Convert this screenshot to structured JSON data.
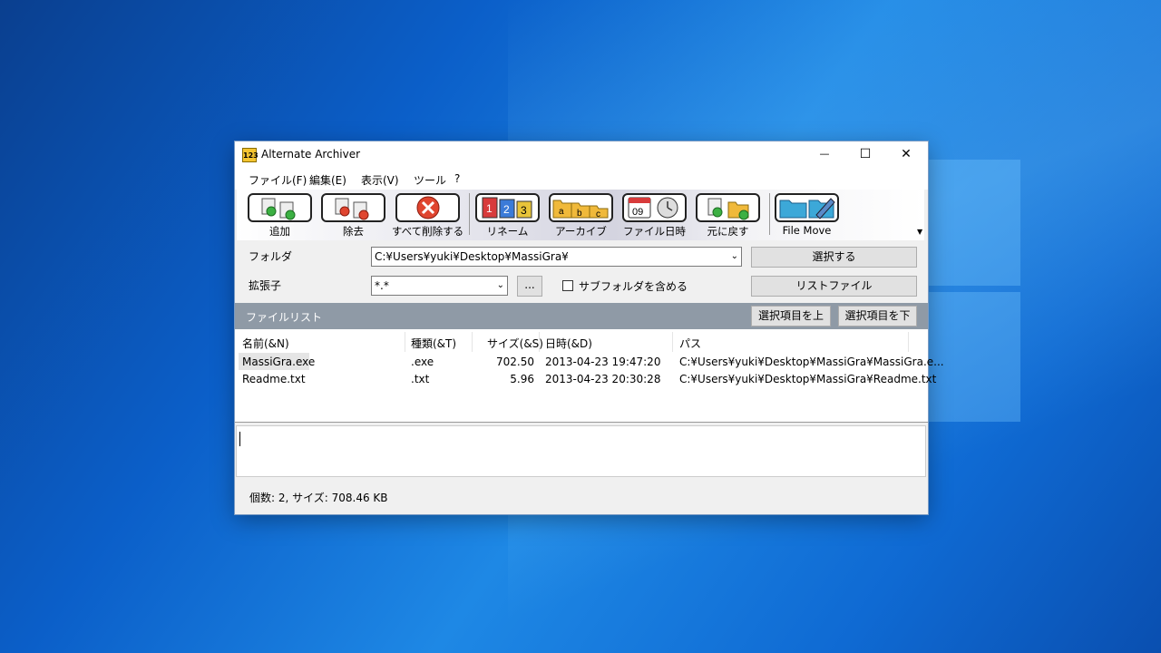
{
  "window": {
    "title": "Alternate Archiver"
  },
  "titlebar_buttons": {
    "minimize": "—",
    "maximize": "☐",
    "close": "✕"
  },
  "menu": [
    "ファイル(F)",
    "編集(E)",
    "表示(V)",
    "ツール",
    "?"
  ],
  "toolbar": {
    "add": "追加",
    "remove": "除去",
    "remove_all": "すべて削除する",
    "rename": "リネーム",
    "archive": "アーカイブ",
    "file_date": "ファイル日時",
    "restore": "元に戻す",
    "file_move": "File Move"
  },
  "folder": {
    "label": "フォルダ",
    "value": "C:¥Users¥yuki¥Desktop¥MassiGra¥",
    "select_button": "選択する"
  },
  "extension": {
    "label": "拡張子",
    "value": "*.*",
    "browse_button": "...",
    "subfolder_label": "サブフォルダを含める",
    "subfolder_checked": false,
    "list_file_button": "リストファイル"
  },
  "filelist": {
    "title": "ファイルリスト",
    "move_up_button": "選択項目を上",
    "move_down_button": "選択項目を下",
    "columns": [
      "名前(&N)",
      "種類(&T)",
      "サイズ(&S)",
      "日時(&D)",
      "パス"
    ],
    "rows": [
      {
        "name": "MassiGra.exe",
        "type": ".exe",
        "size": "702.50",
        "date": "2013-04-23 19:47:20",
        "path": "C:¥Users¥yuki¥Desktop¥MassiGra¥MassiGra.e..."
      },
      {
        "name": "Readme.txt",
        "type": ".txt",
        "size": "5.96",
        "date": "2013-04-23 20:30:28",
        "path": "C:¥Users¥yuki¥Desktop¥MassiGra¥Readme.txt"
      }
    ]
  },
  "status": "個数: 2, サイズ: 708.46 KB"
}
